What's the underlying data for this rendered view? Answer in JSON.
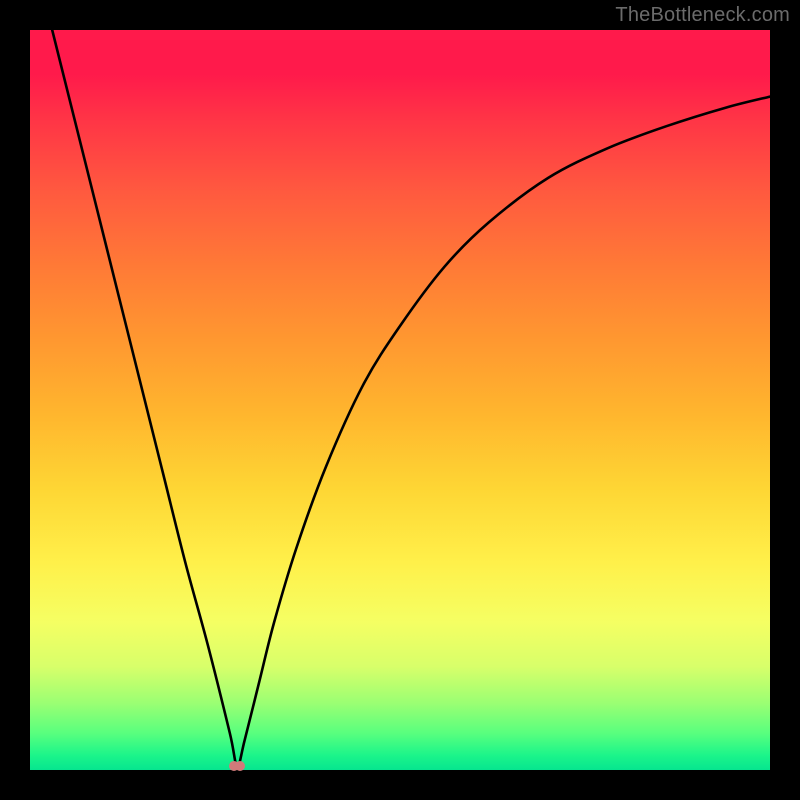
{
  "watermark": "TheBottleneck.com",
  "colors": {
    "frame": "#000000",
    "curve": "#000000",
    "marker": "#d17a7a",
    "gradient_stops": [
      "#ff1a4b",
      "#ff3446",
      "#ff5a3f",
      "#ff7a36",
      "#ff9830",
      "#ffb62e",
      "#fed634",
      "#fff04a",
      "#f5ff63",
      "#d8ff6a",
      "#9aff73",
      "#59ff7e",
      "#1cf58a",
      "#06e58f"
    ]
  },
  "chart_data": {
    "type": "line",
    "title": "",
    "xlabel": "",
    "ylabel": "",
    "xlim": [
      0,
      100
    ],
    "ylim": [
      0,
      100
    ],
    "grid": false,
    "legend": false,
    "note": "V-shaped bottleneck curve; y≈0 at vertex x≈28, rises steeply toward edges. Values are visual estimates (no axis labels in source).",
    "series": [
      {
        "name": "bottleneck-curve",
        "x": [
          3,
          6,
          9,
          12,
          15,
          18,
          21,
          24,
          27,
          28,
          29,
          31,
          33,
          36,
          40,
          45,
          50,
          56,
          62,
          70,
          78,
          86,
          94,
          100
        ],
        "y": [
          100,
          88,
          76,
          64,
          52,
          40,
          28,
          17,
          5,
          0.5,
          4,
          12,
          20,
          30,
          41,
          52,
          60,
          68,
          74,
          80,
          84,
          87,
          89.5,
          91
        ]
      }
    ],
    "vertex": {
      "x": 28,
      "y": 0.5
    },
    "marker": {
      "x": 28,
      "y": 0.5
    }
  }
}
